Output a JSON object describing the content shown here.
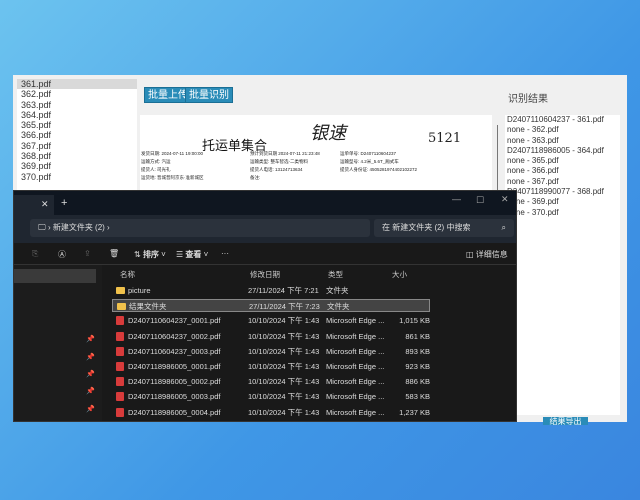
{
  "app": {
    "files": [
      "361.pdf",
      "362.pdf",
      "363.pdf",
      "364.pdf",
      "365.pdf",
      "366.pdf",
      "367.pdf",
      "368.pdf",
      "369.pdf",
      "370.pdf"
    ],
    "buttons": {
      "upload": "批量上传",
      "recognize": "批量识别",
      "export": "结果导出"
    },
    "document": {
      "title": "托运单集合",
      "signature": "银速",
      "mark": "5121",
      "fields": [
        "发货日期: 2024-07-11 19:00:00",
        "运输方式: 汽运",
        "提货人: 司光礼",
        "运货地: 晋城普阿京东·准新城区",
        "预计到货日期 2024-07-11 21:23:48",
        "运输类型: 整车智选-二类物料",
        "提货人电话: 13124713634",
        "备注:",
        "运单单号: D2407110604237",
        "运输型号: 4.2米_5.6T_厢式车",
        "提货人身份证: 4505281974402102272"
      ]
    },
    "results_title": "识别结果",
    "results": [
      "D2407110604237 - 361.pdf",
      "none - 362.pdf",
      "none - 363.pdf",
      "D2407118986005 - 364.pdf",
      "none - 365.pdf",
      "none - 366.pdf",
      "none - 367.pdf",
      "D2407118990077 - 368.pdf",
      "none - 369.pdf",
      "none - 370.pdf"
    ]
  },
  "explorer": {
    "breadcrumb": "新建文件夹 (2)",
    "search_placeholder": "在 新建文件夹 (2) 中搜索",
    "toolbar": {
      "sort": "排序",
      "view": "查看",
      "more": "···",
      "details": "详细信息"
    },
    "columns": [
      "名称",
      "修改日期",
      "类型",
      "大小"
    ],
    "rows": [
      {
        "name": "picture",
        "date": "27/11/2024 下午 7:21",
        "type": "文件夹",
        "size": "",
        "icon": "folder-icon"
      },
      {
        "name": "结果文件夹",
        "date": "27/11/2024 下午 7:23",
        "type": "文件夹",
        "size": "",
        "icon": "folder-icon",
        "selected": true
      },
      {
        "name": "D2407110604237_0001.pdf",
        "date": "10/10/2024 下午 1:43",
        "type": "Microsoft Edge ...",
        "size": "1,015 KB",
        "icon": "pdf-icon"
      },
      {
        "name": "D2407110604237_0002.pdf",
        "date": "10/10/2024 下午 1:43",
        "type": "Microsoft Edge ...",
        "size": "861 KB",
        "icon": "pdf-icon"
      },
      {
        "name": "D2407110604237_0003.pdf",
        "date": "10/10/2024 下午 1:43",
        "type": "Microsoft Edge ...",
        "size": "893 KB",
        "icon": "pdf-icon"
      },
      {
        "name": "D2407118986005_0001.pdf",
        "date": "10/10/2024 下午 1:43",
        "type": "Microsoft Edge ...",
        "size": "923 KB",
        "icon": "pdf-icon"
      },
      {
        "name": "D2407118986005_0002.pdf",
        "date": "10/10/2024 下午 1:43",
        "type": "Microsoft Edge ...",
        "size": "886 KB",
        "icon": "pdf-icon"
      },
      {
        "name": "D2407118986005_0003.pdf",
        "date": "10/10/2024 下午 1:43",
        "type": "Microsoft Edge ...",
        "size": "583 KB",
        "icon": "pdf-icon"
      },
      {
        "name": "D2407118986005_0004.pdf",
        "date": "10/10/2024 下午 1:43",
        "type": "Microsoft Edge ...",
        "size": "1,237 KB",
        "icon": "pdf-icon"
      }
    ]
  }
}
